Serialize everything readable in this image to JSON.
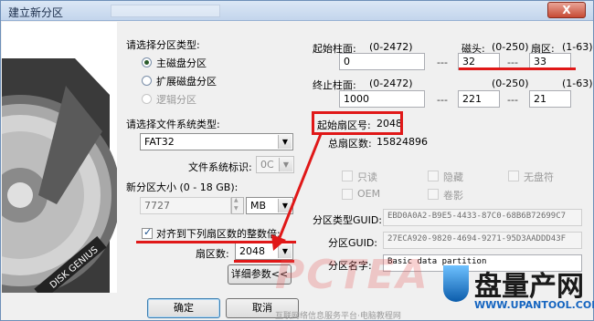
{
  "window": {
    "title": "建立新分区",
    "close_label": "X"
  },
  "left": {
    "partition_type_label": "请选择分区类型:",
    "partition_types": [
      {
        "label": "主磁盘分区",
        "checked": true,
        "disabled": false
      },
      {
        "label": "扩展磁盘分区",
        "checked": false,
        "disabled": false
      },
      {
        "label": "逻辑分区",
        "checked": false,
        "disabled": true
      }
    ],
    "fs_type_label": "请选择文件系统类型:",
    "fs_type_value": "FAT32",
    "fs_id_label": "文件系统标识:",
    "fs_id_value": "0C",
    "size_label": "新分区大小 (0 - 18 GB):",
    "size_value": "7727",
    "size_unit": "MB",
    "align_label": "对齐到下列扇区数的整数倍:",
    "align_checked": true,
    "sector_label": "扇区数:",
    "sector_value": "2048",
    "details_button": "详细参数<<",
    "ok_button": "确定",
    "cancel_button": "取消"
  },
  "right": {
    "start_cyl_label": "起始柱面:",
    "start_cyl_range": "(0-2472)",
    "start_cyl_value": "0",
    "start_head_label": "磁头:",
    "start_head_range": "(0-250)",
    "start_head_value": "32",
    "start_sector_label": "扇区:",
    "start_sector_range": "(1-63)",
    "start_sector_value": "33",
    "end_cyl_label": "终止柱面:",
    "end_cyl_range": "(0-2472)",
    "end_cyl_value": "1000",
    "end_head_range": "(0-250)",
    "end_head_value": "221",
    "end_sector_range": "(1-63)",
    "end_sector_value": "21",
    "dash": "---",
    "start_lba_label": "起始扇区号:",
    "start_lba_value": "2048",
    "total_sectors_label": "总扇区数:",
    "total_sectors_value": "15824896",
    "attr_readonly": "只读",
    "attr_hidden": "隐藏",
    "attr_nodrive": "无盘符",
    "attr_oem": "OEM",
    "attr_shadow": "卷影",
    "type_guid_label": "分区类型GUID:",
    "type_guid_value": "EBD0A0A2-B9E5-4433-87C0-68B6B72699C7",
    "part_guid_label": "分区GUID:",
    "part_guid_value": "27ECA920-9820-4694-9271-95D3AADDD43F",
    "part_name_label": "分区名字:",
    "part_name_value": "Basic data partition"
  },
  "overlay": {
    "watermark_text": "PCTEA",
    "watermark_site": "互联网络信息服务平台·电脑教程网",
    "logo_name": "盘量产网",
    "logo_site": "WWW.UPANTOOL.COM",
    "accent_red": "#e01818"
  }
}
